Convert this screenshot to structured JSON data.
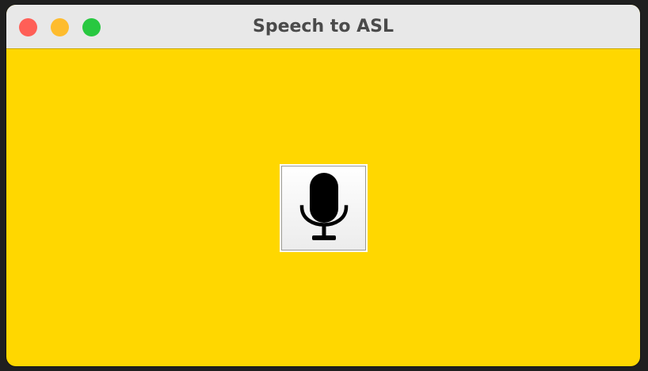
{
  "window": {
    "title": "Speech to ASL",
    "background_color": "#ffd700",
    "controls": {
      "close_color": "#ff5f57",
      "minimize_color": "#febc2e",
      "zoom_color": "#28c840"
    }
  },
  "main": {
    "mic_button": {
      "icon": "microphone-icon"
    }
  }
}
